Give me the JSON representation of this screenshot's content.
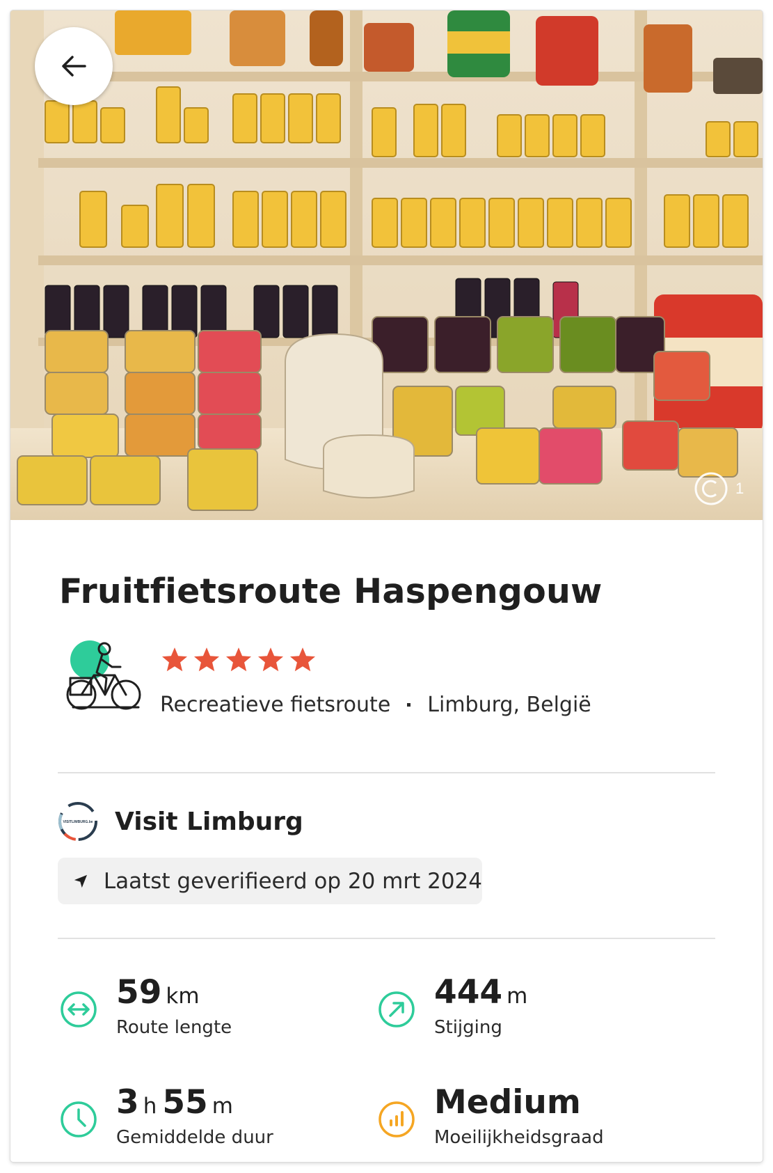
{
  "header": {
    "back_icon": "arrow-left-icon",
    "photo_copyright_icon": "copyright-icon",
    "photo_counter": "1"
  },
  "route": {
    "title": "Fruitfietsroute Haspengouw",
    "activity_icon": "cyclist-icon",
    "rating": 5,
    "rating_max": 5,
    "type": "Recreatieve fietsroute",
    "region": "Limburg, België"
  },
  "organization": {
    "name": "Visit Limburg",
    "logo_text": "VISITLIMBURG.be",
    "verified_icon": "navigation-arrow-icon",
    "verified_text": "Laatst geverifieerd op 20 mrt 2024"
  },
  "stats": {
    "length": {
      "value": "59",
      "unit": "km",
      "label": "Route lengte",
      "icon": "distance-icon"
    },
    "ascent": {
      "value": "444",
      "unit": "m",
      "label": "Stijging",
      "icon": "ascent-icon"
    },
    "duration": {
      "hours": "3",
      "hours_unit": "h",
      "minutes": "55",
      "minutes_unit": "m",
      "label": "Gemiddelde duur",
      "icon": "clock-icon"
    },
    "difficulty": {
      "value": "Medium",
      "label": "Moeilijkheidsgraad",
      "icon": "difficulty-icon"
    }
  },
  "colors": {
    "accent_green": "#2ecc9a",
    "star_orange": "#e8553a",
    "difficulty_yellow": "#f5a623",
    "text_dark": "#1f1f1f",
    "divider": "#e1e1e1",
    "chip_bg": "#f1f1f1"
  }
}
